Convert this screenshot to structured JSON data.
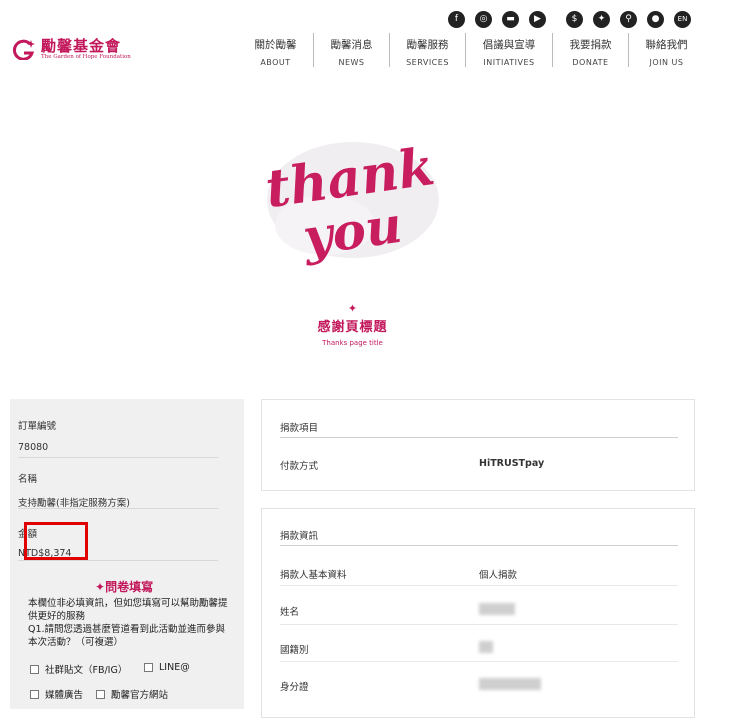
{
  "header": {
    "logo_cn": "勵馨基金會",
    "logo_en": "The Garden of Hope Foundation",
    "social_icons": [
      "facebook-icon",
      "instagram-icon",
      "line-icon",
      "youtube-icon"
    ],
    "utility_icons": [
      "donate-icon",
      "candle-icon",
      "search-icon",
      "user-icon"
    ],
    "lang_label": "EN",
    "nav": [
      {
        "cn": "關於勵馨",
        "en": "ABOUT"
      },
      {
        "cn": "勵馨消息",
        "en": "NEWS"
      },
      {
        "cn": "勵馨服務",
        "en": "SERVICES"
      },
      {
        "cn": "倡議與宣導",
        "en": "INITIATIVES"
      },
      {
        "cn": "我要捐款",
        "en": "DONATE"
      },
      {
        "cn": "聯絡我們",
        "en": "JOIN US"
      }
    ]
  },
  "hero": {
    "art_line1": "thank",
    "art_line2": "you",
    "title": "感謝頁標題",
    "subtitle": "Thanks page title"
  },
  "order": {
    "order_no_label": "訂單編號",
    "order_no": "78080",
    "name_label": "名稱",
    "name_value": "支持勵馨(非指定服務方案)",
    "amount_label": "金額",
    "amount_value": "NTD$8,374"
  },
  "survey": {
    "title": "問卷填寫",
    "note": "本欄位非必填資訊，但如您填寫可以幫助勵馨提供更好的服務",
    "q1": "Q1.請問您透過甚麼管道看到此活動並進而參與本次活動？（可複選）",
    "options": [
      "社群貼文（FB/IG）",
      "LINE@",
      "媒體廣告",
      "勵馨官方網站"
    ]
  },
  "donation_card": {
    "title": "捐款項目",
    "payment_label": "付款方式",
    "payment_value": "HiTRUSTpay"
  },
  "donor_card": {
    "title": "捐款資訊",
    "basic_label": "捐款人基本資料",
    "basic_value": "個人捐款",
    "name_label": "姓名",
    "nationality_label": "國籍別",
    "id_label": "身分證"
  },
  "colors": {
    "brand": "#c2185b",
    "highlight": "#e00000",
    "panel_bg": "#f0f0f0"
  }
}
